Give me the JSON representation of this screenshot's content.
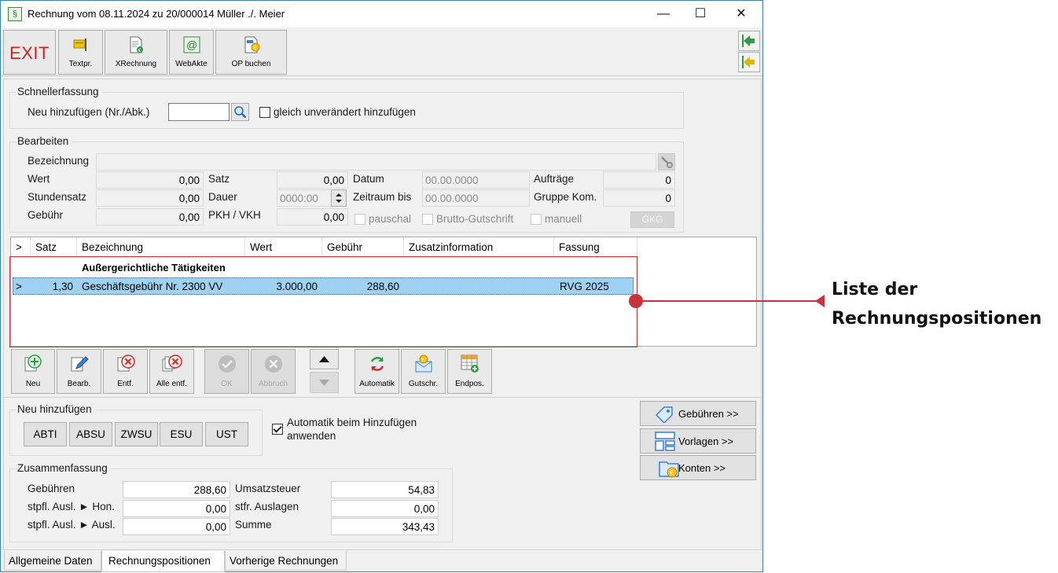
{
  "window": {
    "title": "Rechnung vom 08.11.2024 zu 20/000014  Müller ./. Meier",
    "icon_glyph": "§",
    "minimize": "—",
    "maximize": "☐",
    "close": "✕"
  },
  "toolbar": {
    "exit": "EXIT",
    "textpr": "Textpr.",
    "xrechnung": "XRechnung",
    "webakte": "WebAkte",
    "op_buchen": "OP buchen"
  },
  "schnellerfassung": {
    "title": "Schnellerfassung",
    "neu_label": "Neu hinzufügen (Nr./Abk.)",
    "neu_value": "",
    "gleich_label": "gleich unverändert hinzufügen",
    "gleich_checked": false
  },
  "bearbeiten": {
    "title": "Bearbeiten",
    "bezeichnung_label": "Bezeichnung",
    "bezeichnung_value": "",
    "wert_label": "Wert",
    "wert_value": "0,00",
    "stundensatz_label": "Stundensatz",
    "stundensatz_value": "0,00",
    "gebuehr_label": "Gebühr",
    "gebuehr_value": "0,00",
    "satz_label": "Satz",
    "satz_value": "0,00",
    "dauer_label": "Dauer",
    "dauer_value": "0000:00",
    "pkh_label": "PKH / VKH",
    "pkh_value": "0,00",
    "datum_label": "Datum",
    "datum_value": "00.00.0000",
    "zeitraum_label": "Zeitraum bis",
    "zeitraum_value": "00.00.0000",
    "pauschal_label": "pauschal",
    "brutto_label": "Brutto-Gutschrift",
    "auftraege_label": "Aufträge",
    "auftraege_value": "0",
    "gruppe_label": "Gruppe Kom.",
    "gruppe_value": "0",
    "manuell_label": "manuell",
    "gkg_label": "GKG"
  },
  "table": {
    "columns": [
      ">",
      "Satz",
      "Bezeichnung",
      "Wert",
      "Gebühr",
      "Zusatzinformation",
      "Fassung"
    ],
    "group_header": "Außergerichtliche Tätigkeiten",
    "rows": [
      {
        "marker": ">",
        "satz": "1,30",
        "bezeichnung": "Geschäftsgebühr Nr. 2300 VV",
        "wert": "3.000,00",
        "gebuehr": "288,60",
        "zusatz": "",
        "fassung": "RVG 2025"
      }
    ]
  },
  "actions": {
    "neu": "Neu",
    "bearb": "Bearb.",
    "entf": "Entf.",
    "alle_entf": "Alle entf.",
    "ok": "OK",
    "abbruch": "Abbruch",
    "automatik": "Automatik",
    "gutschr": "Gutschr.",
    "endpos": "Endpos."
  },
  "neu_hinzufuegen": {
    "title": "Neu hinzufügen",
    "buttons": [
      "ABTI",
      "ABSU",
      "ZWSU",
      "ESU",
      "UST"
    ],
    "automatik_line1": "Automatik beim Hinzufügen",
    "automatik_line2": "anwenden",
    "automatik_checked": true
  },
  "right_buttons": {
    "gebuehren": "Gebühren >>",
    "vorlagen": "Vorlagen >>",
    "konten": "Konten >>"
  },
  "zusammenfassung": {
    "title": "Zusammenfassung",
    "gebuehren_label": "Gebühren",
    "gebuehren_value": "288,60",
    "ausl_hon_label": "stpfl. Ausl. ► Hon.",
    "ausl_hon_value": "0,00",
    "ausl_ausl_label": "stpfl. Ausl. ► Ausl.",
    "ausl_ausl_value": "0,00",
    "ust_label": "Umsatzsteuer",
    "ust_value": "54,83",
    "stfr_label": "stfr. Auslagen",
    "stfr_value": "0,00",
    "summe_label": "Summe",
    "summe_value": "343,43"
  },
  "tabs": [
    "Allgemeine Daten",
    "Rechnungspositionen",
    "Vorherige Rechnungen"
  ],
  "active_tab": 1,
  "callout": {
    "line1": "Liste der",
    "line2": "Rechnungspositionen"
  },
  "colors": {
    "accent_red": "#c8323c",
    "selection": "#9fd1f5",
    "exit_red": "#d41f1f"
  }
}
